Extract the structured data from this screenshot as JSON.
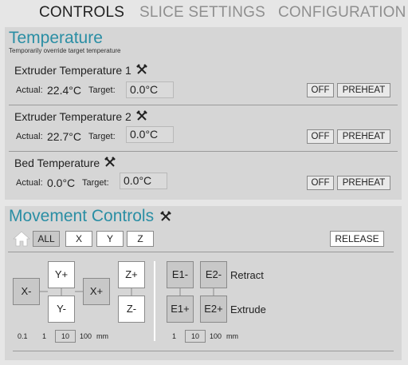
{
  "tabs": [
    {
      "label": "CONTROLS",
      "active": true
    },
    {
      "label": "SLICE SETTINGS",
      "active": false
    },
    {
      "label": "CONFIGURATION",
      "active": false
    }
  ],
  "temperature": {
    "title": "Temperature",
    "subtitle": "Temporarily override target temperature",
    "actual_label": "Actual:",
    "target_label": "Target:",
    "heaters": [
      {
        "name": "Extruder Temperature 1",
        "actual": "22.4°C",
        "target": "0.0°C",
        "off_label": "OFF",
        "preheat_label": "PREHEAT"
      },
      {
        "name": "Extruder Temperature 2",
        "actual": "22.7°C",
        "target": "0.0°C",
        "off_label": "OFF",
        "preheat_label": "PREHEAT"
      },
      {
        "name": "Bed Temperature",
        "actual": "0.0°C",
        "target": "0.0°C",
        "off_label": "OFF",
        "preheat_label": "PREHEAT"
      }
    ]
  },
  "movement": {
    "title": "Movement Controls",
    "axis_buttons": [
      "ALL",
      "X",
      "Y",
      "Z"
    ],
    "release_label": "RELEASE",
    "jog": {
      "x_minus": "X-",
      "x_plus": "X+",
      "y_plus": "Y+",
      "y_minus": "Y-",
      "z_plus": "Z+",
      "z_minus": "Z-",
      "e1_minus": "E1-",
      "e2_minus": "E2-",
      "e1_plus": "E1+",
      "e2_plus": "E2+",
      "retract_label": "Retract",
      "extrude_label": "Extrude"
    },
    "xyz_steps": [
      "0.1",
      "1",
      "10",
      "100"
    ],
    "xyz_steps_unit": "mm",
    "xyz_selected_step": "10",
    "e_steps": [
      "1",
      "10",
      "100"
    ],
    "e_steps_unit": "mm",
    "e_selected_step": "10"
  },
  "colors": {
    "accent": "#2a8ea4",
    "panel_bg": "#d6d6d6",
    "page_bg": "#e6e6e6"
  }
}
